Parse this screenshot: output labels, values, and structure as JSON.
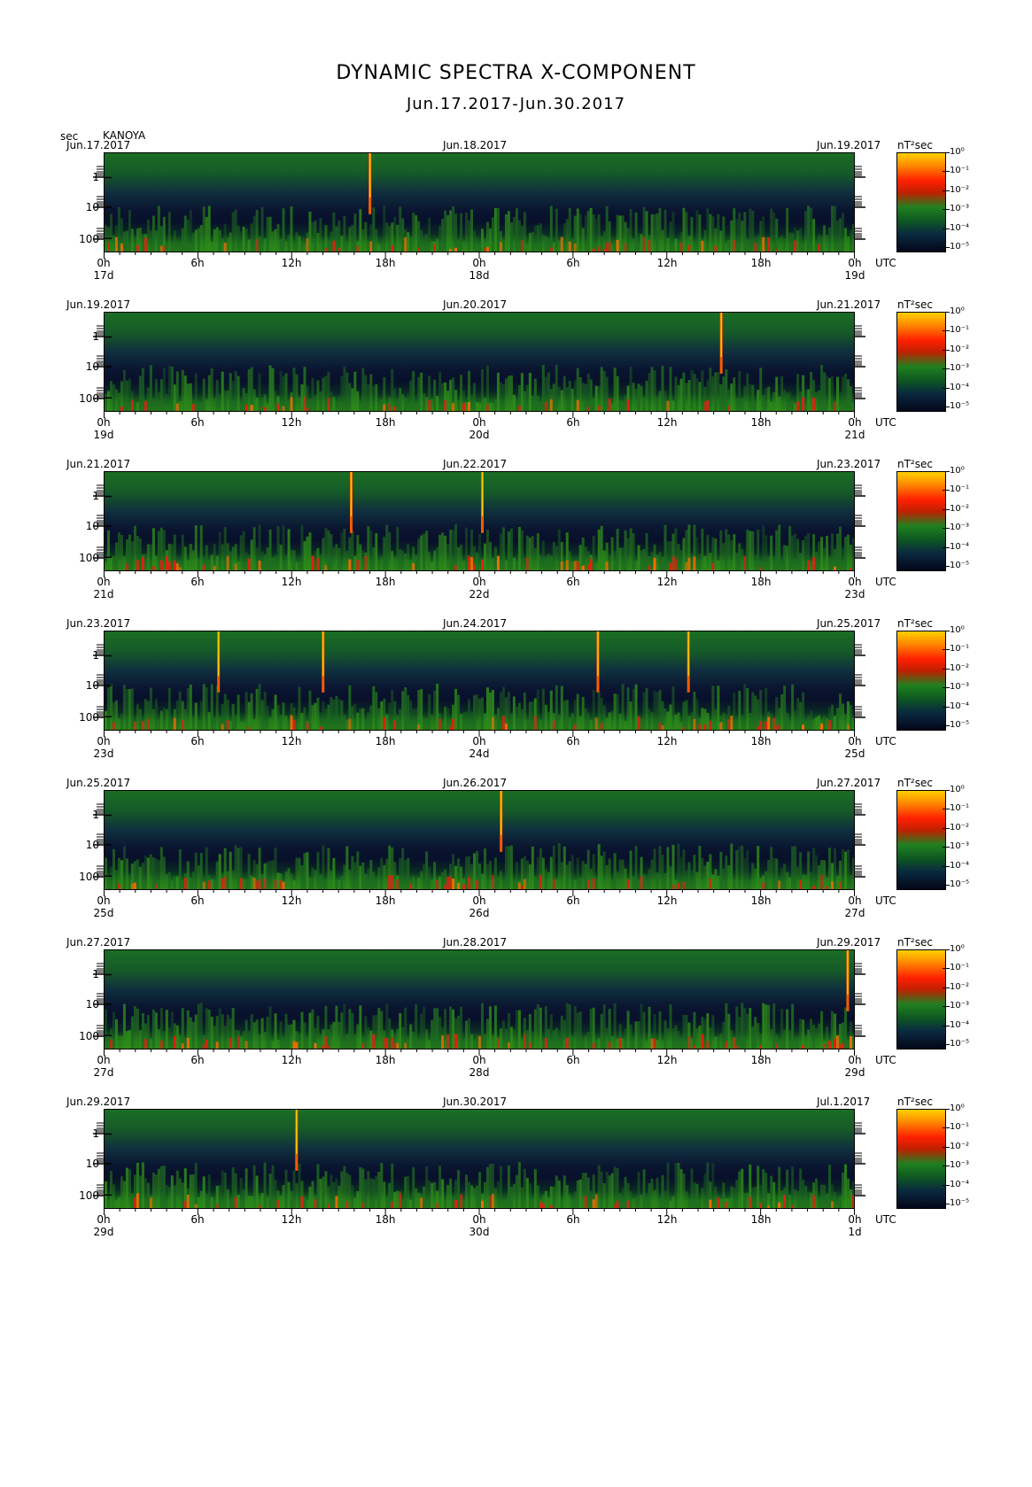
{
  "header": {
    "title": "DYNAMIC SPECTRA X-COMPONENT",
    "subtitle": "Jun.17.2017-Jun.30.2017",
    "y_unit": "sec",
    "station": "KANOYA"
  },
  "chart_data": {
    "type": "heatmap",
    "title": "DYNAMIC SPECTRA X-COMPONENT",
    "subtitle": "Jun.17.2017-Jun.30.2017",
    "ylabel": "sec",
    "y_scale": "log",
    "y_ticks": [
      "1",
      "10",
      "100"
    ],
    "x_ticks": [
      "0h",
      "6h",
      "12h",
      "18h",
      "0h",
      "6h",
      "12h",
      "18h",
      "0h"
    ],
    "x_unit": "UTC",
    "colorbar": {
      "unit": "nT²sec",
      "labels": [
        "10⁰",
        "10⁻¹",
        "10⁻²",
        "10⁻³",
        "10⁻⁴",
        "10⁻⁵"
      ],
      "colors": [
        "#ffd000",
        "#ff2000",
        "#1f7a1f",
        "#0a2a40",
        "#04061a"
      ]
    },
    "panels": [
      {
        "date_left": "Jun.17.2017",
        "date_mid": "Jun.18.2017",
        "date_right": "Jun.19.2017",
        "day_left": "17d",
        "day_mid": "18d",
        "day_right": "19d",
        "spikes_h": [
          17.0
        ]
      },
      {
        "date_left": "Jun.19.2017",
        "date_mid": "Jun.20.2017",
        "date_right": "Jun.21.2017",
        "day_left": "19d",
        "day_mid": "20d",
        "day_right": "21d",
        "spikes_h": [
          39.5
        ]
      },
      {
        "date_left": "Jun.21.2017",
        "date_mid": "Jun.22.2017",
        "date_right": "Jun.23.2017",
        "day_left": "21d",
        "day_mid": "22d",
        "day_right": "23d",
        "spikes_h": [
          15.8,
          24.2
        ]
      },
      {
        "date_left": "Jun.23.2017",
        "date_mid": "Jun.24.2017",
        "date_right": "Jun.25.2017",
        "day_left": "23d",
        "day_mid": "24d",
        "day_right": "25d",
        "spikes_h": [
          7.3,
          14.0,
          31.6,
          37.4
        ]
      },
      {
        "date_left": "Jun.25.2017",
        "date_mid": "Jun.26.2017",
        "date_right": "Jun.27.2017",
        "day_left": "25d",
        "day_mid": "26d",
        "day_right": "27d",
        "spikes_h": [
          25.4
        ]
      },
      {
        "date_left": "Jun.27.2017",
        "date_mid": "Jun.28.2017",
        "date_right": "Jun.29.2017",
        "day_left": "27d",
        "day_mid": "28d",
        "day_right": "29d",
        "spikes_h": [
          47.6
        ]
      },
      {
        "date_left": "Jun.29.2017",
        "date_mid": "Jun.30.2017",
        "date_right": "Jul.1.2017",
        "day_left": "29d",
        "day_mid": "30d",
        "day_right": "1d",
        "spikes_h": [
          12.3
        ]
      }
    ]
  }
}
